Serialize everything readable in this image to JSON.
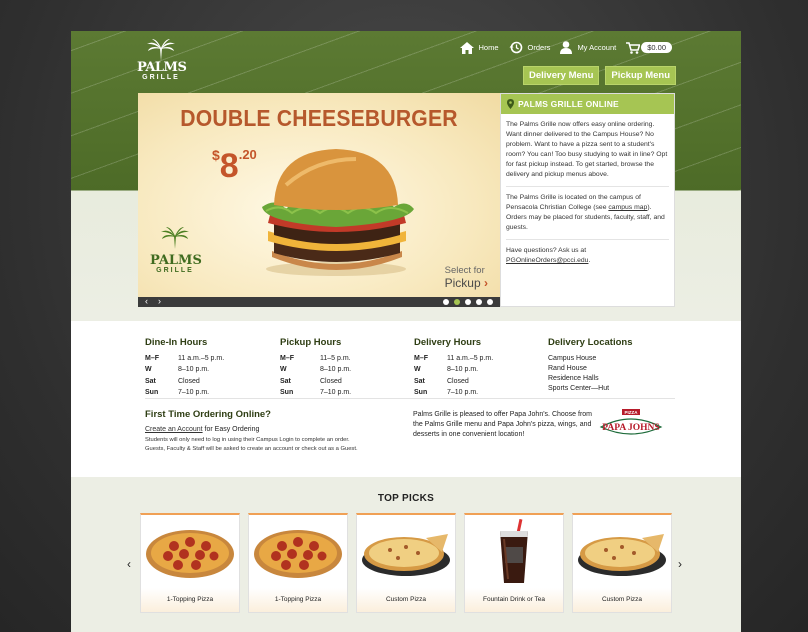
{
  "header": {
    "logo_line1": "PALMS",
    "logo_line2": "GRILLE",
    "nav": [
      {
        "label": "Home",
        "icon": "home-icon"
      },
      {
        "label": "Orders",
        "icon": "history-icon"
      },
      {
        "label": "My Account",
        "icon": "user-icon"
      }
    ],
    "cart_total": "$0.00",
    "delivery_menu": "Delivery Menu",
    "pickup_menu": "Pickup Menu"
  },
  "hero": {
    "title": "DOUBLE CHEESEBURGER",
    "price_dollar_sign": "$",
    "price_dollars": "8",
    "price_cents": ".20",
    "logo_line1": "PALMS",
    "logo_line2": "GRILLE",
    "cta_line1": "Select for",
    "cta_line2": "Pickup",
    "slide_count": 5,
    "active_slide": 2
  },
  "info": {
    "heading": "PALMS GRILLE ONLINE",
    "para1": "The Palms Grille now offers easy online ordering. Want dinner delivered to the Campus House? No problem. Want to have a pizza sent to a student's room? You can! Too busy studying to wait in line? Opt for fast pickup instead. To get started, browse the delivery and pickup menus above.",
    "para2_a": "The Palms Grille is located on the campus of Pensacola Christian College (see ",
    "para2_link": "campus map",
    "para2_b": "). Orders may be placed for students, faculty, staff, and guests.",
    "para3_a": "Have questions? Ask us at",
    "para3_link": "PGOnlineOrders@pcci.edu",
    "para3_b": "."
  },
  "hours": {
    "dine_in": {
      "title": "Dine-In Hours",
      "rows": [
        [
          "M–F",
          "11 a.m.–5 p.m."
        ],
        [
          "W",
          "8–10 p.m."
        ],
        [
          "Sat",
          "Closed"
        ],
        [
          "Sun",
          "7–10 p.m."
        ]
      ]
    },
    "pickup": {
      "title": "Pickup Hours",
      "rows": [
        [
          "M–F",
          "11–5 p.m."
        ],
        [
          "W",
          "8–10 p.m."
        ],
        [
          "Sat",
          "Closed"
        ],
        [
          "Sun",
          "7–10 p.m."
        ]
      ]
    },
    "delivery": {
      "title": "Delivery Hours",
      "rows": [
        [
          "M–F",
          "11 a.m.–5 p.m."
        ],
        [
          "W",
          "8–10 p.m."
        ],
        [
          "Sat",
          "Closed"
        ],
        [
          "Sun",
          "7–10 p.m."
        ]
      ]
    },
    "locations": {
      "title": "Delivery Locations",
      "items": [
        "Campus House",
        "Rand House",
        "Residence Halls",
        "Sports Center—Hut"
      ]
    }
  },
  "first_time": {
    "title": "First Time Ordering Online?",
    "link": "Create an Account",
    "link_suffix": " for Easy Ordering",
    "note1": "Students will only need to log in using their Campus Login to complete an order.",
    "note2": "Guests, Faculty & Staff will be asked to create an account or check out as a Guest."
  },
  "papa": {
    "text": "Palms Grille is pleased to offer Papa John's. Choose from the Palms Grille menu and Papa John's pizza, wings, and desserts in one convenient location!",
    "logo_top": "PIZZA",
    "logo_main": "PAPA JOHNS"
  },
  "top_picks": {
    "title": "TOP PICKS",
    "items": [
      {
        "label": "1-Topping Pizza",
        "kind": "pepperoni"
      },
      {
        "label": "1-Topping Pizza",
        "kind": "pepperoni"
      },
      {
        "label": "Custom Pizza",
        "kind": "custom"
      },
      {
        "label": "Fountain Drink or Tea",
        "kind": "drink"
      },
      {
        "label": "Custom Pizza",
        "kind": "custom"
      }
    ]
  },
  "colors": {
    "green_dark": "#4d6b27",
    "green_light": "#a6c553",
    "orange_text": "#b6582c"
  }
}
